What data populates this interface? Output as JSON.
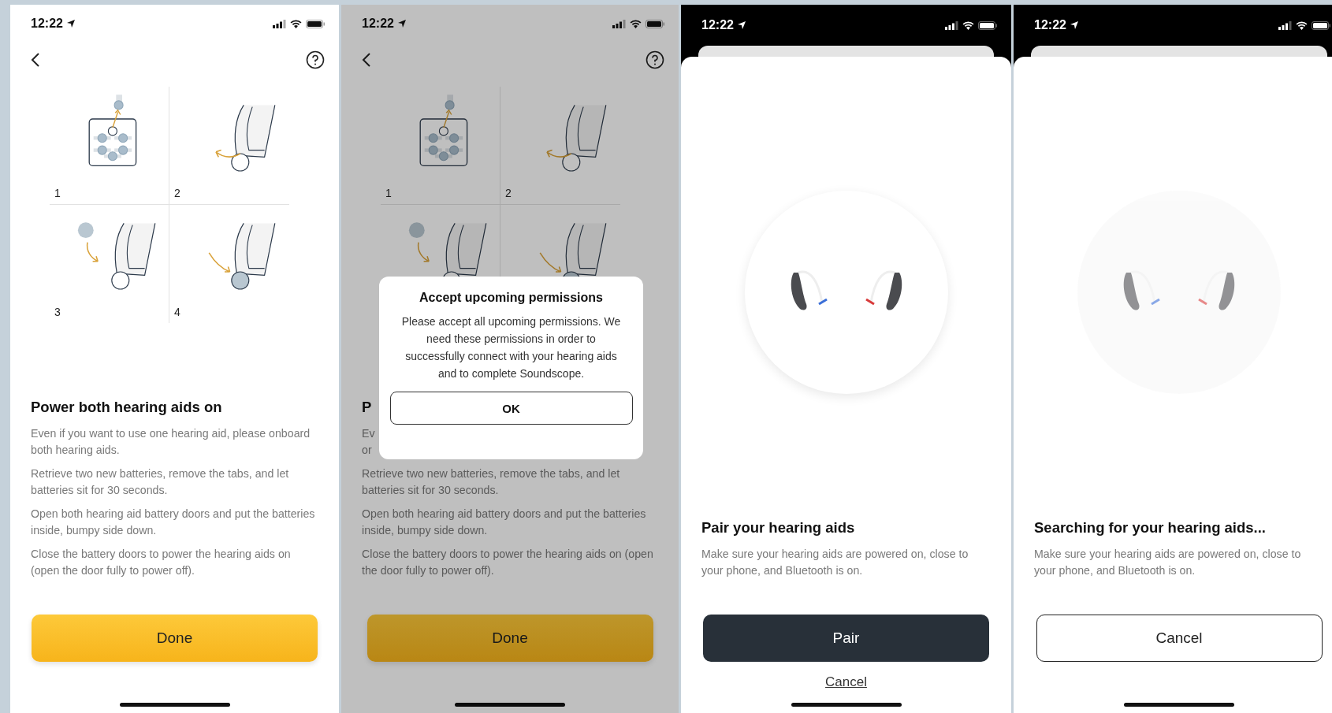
{
  "screens": [
    {
      "kind": "instructions",
      "status_bar": {
        "time": "12:22"
      },
      "step_numbers": [
        "1",
        "2",
        "3",
        "4"
      ],
      "title": "Power both hearing aids on",
      "paragraphs": [
        "Even if you want to use one hearing aid, please onboard both hearing aids.",
        "Retrieve two new batteries, remove the tabs, and let batteries sit for 30 seconds.",
        "Open both hearing aid battery doors and put the batteries inside, bumpy side down.",
        "Close the battery doors to power the hearing aids on (open the door fully to power off)."
      ],
      "button": {
        "label": "Done"
      }
    },
    {
      "kind": "instructions",
      "status_bar": {
        "time": "12:22"
      },
      "dimmed": true,
      "step_numbers": [
        "1",
        "2"
      ],
      "title": "P",
      "paragraphs": [
        "Ev or",
        "Retrieve two new batteries, remove the tabs, and let batteries sit for 30 seconds.",
        "Open both hearing aid battery doors and put the batteries inside, bumpy side down.",
        "Close the battery doors to power the hearing aids on (open the door fully to power off)."
      ],
      "button": {
        "label": "Done"
      },
      "dialog": {
        "title": "Accept upcoming permissions",
        "message": "Please accept all upcoming permissions. We need these permissions in order to successfully connect with your hearing aids and to complete Soundscope.",
        "button": "OK"
      }
    },
    {
      "kind": "sheet",
      "status_bar": {
        "time": "12:22"
      },
      "searching": false,
      "title": "Pair your hearing aids",
      "paragraphs": [
        "Make sure your hearing aids are powered on, close to your phone, and Bluetooth is on."
      ],
      "button": {
        "label": "Pair"
      },
      "link": "Cancel"
    },
    {
      "kind": "sheet",
      "status_bar": {
        "time": "12:22"
      },
      "searching": true,
      "title": "Searching for your hearing aids...",
      "paragraphs": [
        "Make sure your hearing aids are powered on, close to your phone, and Bluetooth is on."
      ],
      "button": {
        "label": "Cancel"
      }
    }
  ]
}
